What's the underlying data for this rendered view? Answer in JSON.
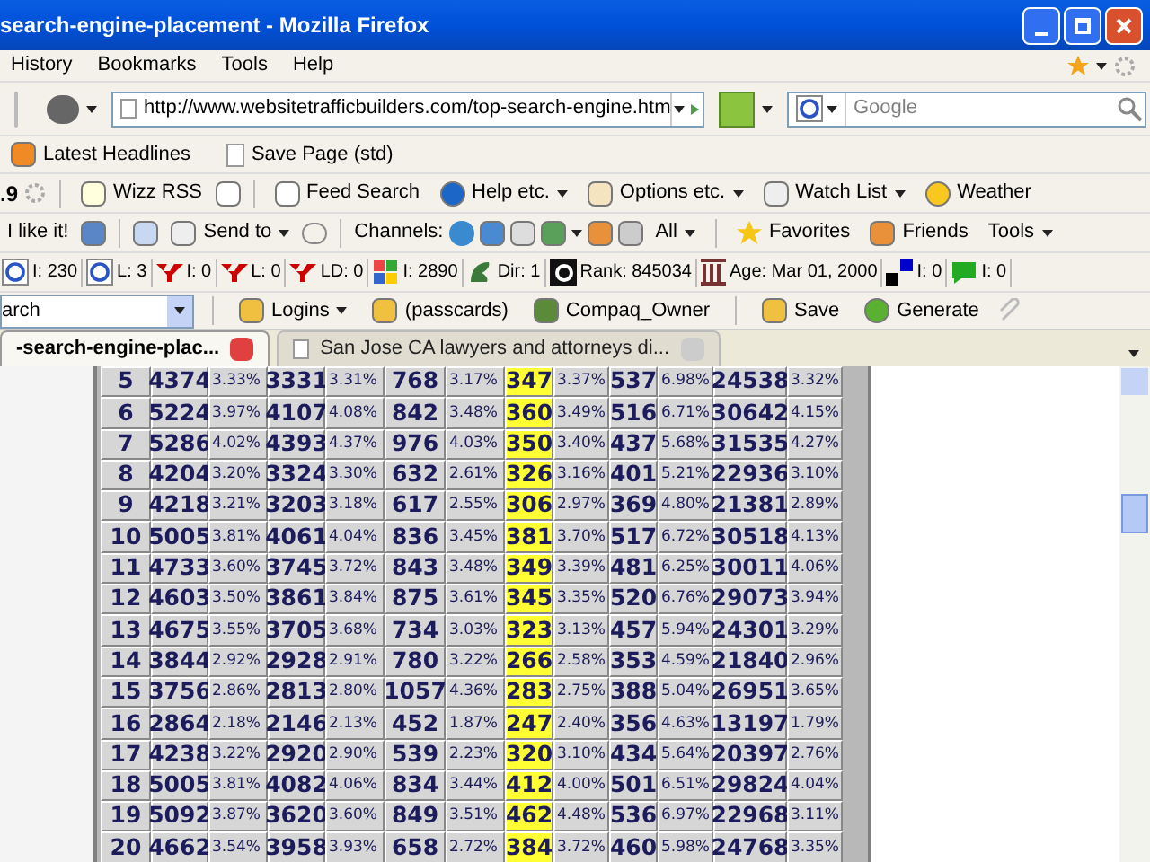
{
  "window": {
    "title": "search-engine-placement - Mozilla Firefox"
  },
  "menu": [
    "History",
    "Bookmarks",
    "Tools",
    "Help"
  ],
  "address": {
    "value": "http://www.websitetrafficbuilders.com/top-search-engine.htm"
  },
  "search": {
    "placeholder": "Google"
  },
  "bookmarks": [
    "Latest Headlines",
    "Save Page (std)"
  ],
  "toolbar_1": {
    "version": ".9",
    "items": [
      {
        "label": "Wizz RSS",
        "menu": false
      },
      {
        "label": "Feed Search",
        "menu": false
      },
      {
        "label": "Help etc.",
        "menu": true
      },
      {
        "label": "Options etc.",
        "menu": true
      },
      {
        "label": "Watch List",
        "menu": true
      },
      {
        "label": "Weather",
        "menu": false
      }
    ]
  },
  "toolbar_2": {
    "like": "I like it!",
    "send": "Send to",
    "channels": "Channels:",
    "all": "All",
    "favorites": "Favorites",
    "friends": "Friends",
    "tools": "Tools"
  },
  "seo_stats": [
    {
      "kind": "google",
      "label": "I: 230"
    },
    {
      "kind": "google",
      "label": "L: 3"
    },
    {
      "kind": "yahoo",
      "label": "I: 0"
    },
    {
      "kind": "yahoo",
      "label": "L: 0"
    },
    {
      "kind": "yahoo",
      "label": "LD: 0"
    },
    {
      "kind": "windows",
      "label": "I: 2890"
    },
    {
      "kind": "dmoz",
      "label": "Dir: 1"
    },
    {
      "kind": "alexa",
      "label": "Rank: 845034"
    },
    {
      "kind": "archive",
      "label": "Age: Mar 01, 2000"
    },
    {
      "kind": "blocks",
      "label": "I: 0"
    },
    {
      "kind": "bubble",
      "label": "I: 0"
    }
  ],
  "toolbar_4": {
    "search_value": "arch",
    "items": [
      {
        "label": "Logins",
        "menu": true
      },
      {
        "label": "(passcards)",
        "menu": false
      },
      {
        "label": "Compaq_Owner",
        "menu": false
      },
      {
        "label": "Save",
        "menu": false
      },
      {
        "label": "Generate",
        "menu": false
      }
    ]
  },
  "tabs": [
    {
      "label": "-search-engine-plac...",
      "selected": true
    },
    {
      "label": "San Jose CA lawyers and attorneys di...",
      "selected": false
    }
  ],
  "table": {
    "rows": [
      [
        "5",
        "4374",
        "3.33%",
        "3331",
        "3.31%",
        "768",
        "3.17%",
        "347",
        "3.37%",
        "537",
        "6.98%",
        "24538",
        "3.32%"
      ],
      [
        "6",
        "5224",
        "3.97%",
        "4107",
        "4.08%",
        "842",
        "3.48%",
        "360",
        "3.49%",
        "516",
        "6.71%",
        "30642",
        "4.15%"
      ],
      [
        "7",
        "5286",
        "4.02%",
        "4393",
        "4.37%",
        "976",
        "4.03%",
        "350",
        "3.40%",
        "437",
        "5.68%",
        "31535",
        "4.27%"
      ],
      [
        "8",
        "4204",
        "3.20%",
        "3324",
        "3.30%",
        "632",
        "2.61%",
        "326",
        "3.16%",
        "401",
        "5.21%",
        "22936",
        "3.10%"
      ],
      [
        "9",
        "4218",
        "3.21%",
        "3203",
        "3.18%",
        "617",
        "2.55%",
        "306",
        "2.97%",
        "369",
        "4.80%",
        "21381",
        "2.89%"
      ],
      [
        "10",
        "5005",
        "3.81%",
        "4061",
        "4.04%",
        "836",
        "3.45%",
        "381",
        "3.70%",
        "517",
        "6.72%",
        "30518",
        "4.13%"
      ],
      [
        "11",
        "4733",
        "3.60%",
        "3745",
        "3.72%",
        "843",
        "3.48%",
        "349",
        "3.39%",
        "481",
        "6.25%",
        "30011",
        "4.06%"
      ],
      [
        "12",
        "4603",
        "3.50%",
        "3861",
        "3.84%",
        "875",
        "3.61%",
        "345",
        "3.35%",
        "520",
        "6.76%",
        "29073",
        "3.94%"
      ],
      [
        "13",
        "4675",
        "3.55%",
        "3705",
        "3.68%",
        "734",
        "3.03%",
        "323",
        "3.13%",
        "457",
        "5.94%",
        "24301",
        "3.29%"
      ],
      [
        "14",
        "3844",
        "2.92%",
        "2928",
        "2.91%",
        "780",
        "3.22%",
        "266",
        "2.58%",
        "353",
        "4.59%",
        "21840",
        "2.96%"
      ],
      [
        "15",
        "3756",
        "2.86%",
        "2813",
        "2.80%",
        "1057",
        "4.36%",
        "283",
        "2.75%",
        "388",
        "5.04%",
        "26951",
        "3.65%"
      ],
      [
        "16",
        "2864",
        "2.18%",
        "2146",
        "2.13%",
        "452",
        "1.87%",
        "247",
        "2.40%",
        "356",
        "4.63%",
        "13197",
        "1.79%"
      ],
      [
        "17",
        "4238",
        "3.22%",
        "2920",
        "2.90%",
        "539",
        "2.23%",
        "320",
        "3.10%",
        "434",
        "5.64%",
        "20397",
        "2.76%"
      ],
      [
        "18",
        "5005",
        "3.81%",
        "4082",
        "4.06%",
        "834",
        "3.44%",
        "412",
        "4.00%",
        "501",
        "6.51%",
        "29824",
        "4.04%"
      ],
      [
        "19",
        "5092",
        "3.87%",
        "3620",
        "3.60%",
        "849",
        "3.51%",
        "462",
        "4.48%",
        "536",
        "6.97%",
        "22968",
        "3.11%"
      ],
      [
        "20",
        "4662",
        "3.54%",
        "3958",
        "3.93%",
        "658",
        "2.72%",
        "384",
        "3.72%",
        "460",
        "5.98%",
        "24768",
        "3.35%"
      ]
    ]
  }
}
